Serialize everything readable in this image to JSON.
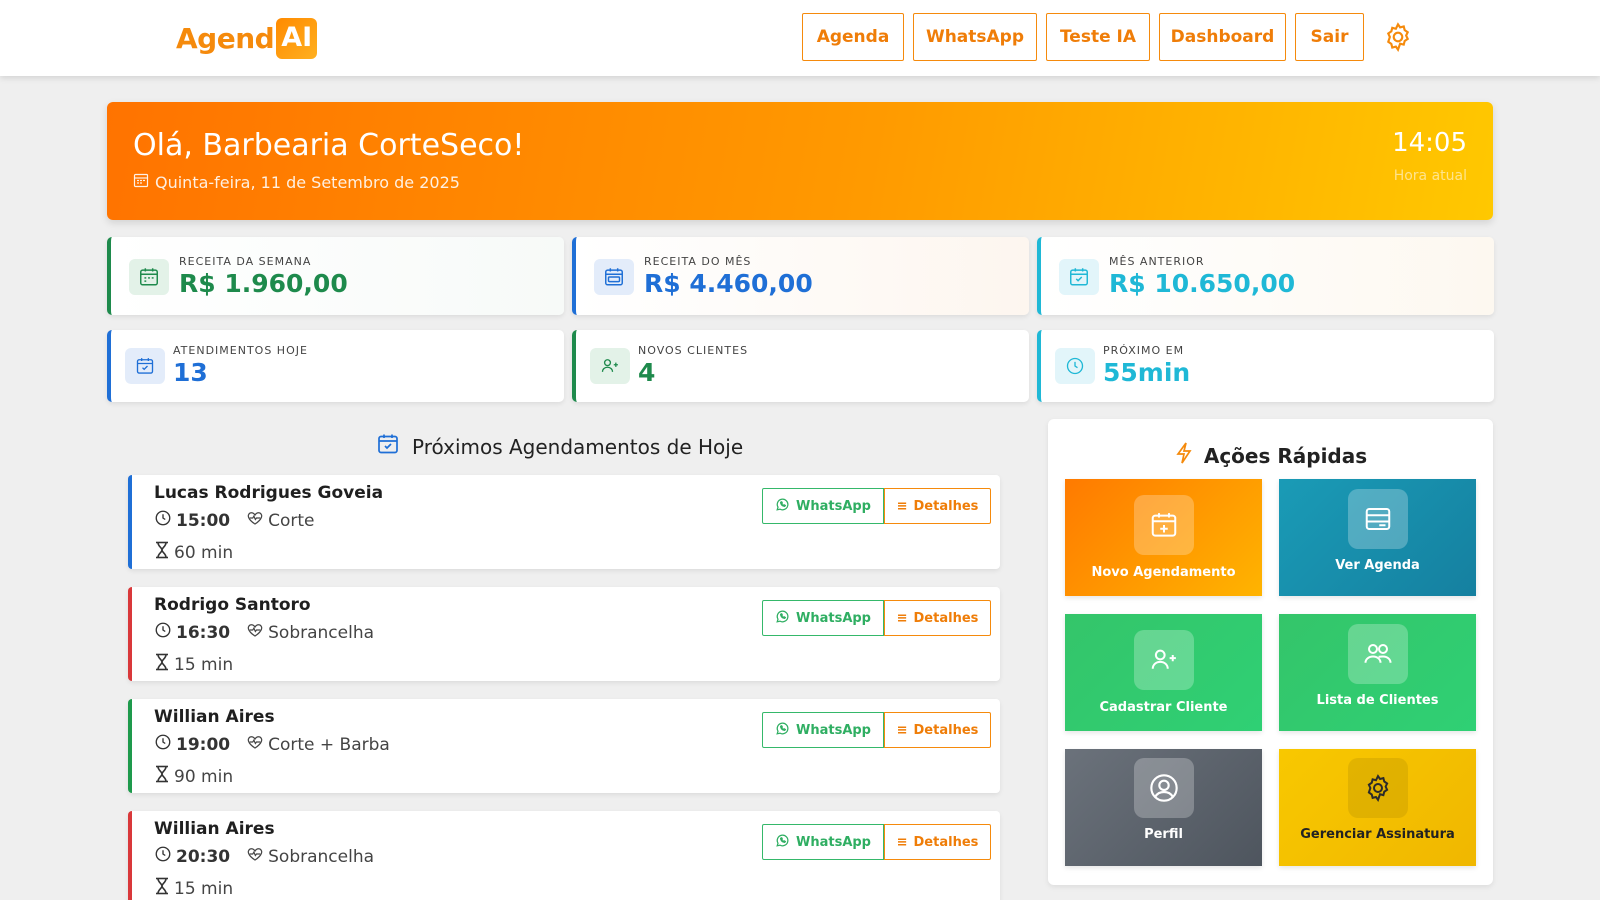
{
  "header": {
    "logo_text": "Agend",
    "logo_box": "AI",
    "nav": [
      "Agenda",
      "WhatsApp",
      "Teste IA",
      "Dashboard",
      "Sair"
    ]
  },
  "banner": {
    "greeting": "Olá, Barbearia CorteSeco!",
    "date": "Quinta-feira, 11 de Setembro de 2025",
    "time": "14:05",
    "time_label": "Hora atual"
  },
  "stats": [
    {
      "label": "RECEITA DA SEMANA",
      "value": "R$ 1.960,00",
      "color": "#1e8a4c"
    },
    {
      "label": "RECEITA DO MÊS",
      "value": "R$ 4.460,00",
      "color": "#1f6fd6"
    },
    {
      "label": "MÊS ANTERIOR",
      "value": "R$ 10.650,00",
      "color": "#1fb8d6"
    },
    {
      "label": "ATENDIMENTOS HOJE",
      "value": "13",
      "color": "#1f6fd6"
    },
    {
      "label": "NOVOS CLIENTES",
      "value": "4",
      "color": "#1e8a4c"
    },
    {
      "label": "PRÓXIMO EM",
      "value": "55min",
      "color": "#1fb8d6"
    }
  ],
  "appointments": {
    "title": "Próximos Agendamentos de Hoje",
    "whatsapp_label": "WhatsApp",
    "details_label": "Detalhes",
    "items": [
      {
        "name": "Lucas Rodrigues Goveia",
        "time": "15:00",
        "service": "Corte",
        "duration": "60 min",
        "color": "#1f6fd6"
      },
      {
        "name": "Rodrigo Santoro",
        "time": "16:30",
        "service": "Sobrancelha",
        "duration": "15 min",
        "color": "#d9383a"
      },
      {
        "name": "Willian Aires",
        "time": "19:00",
        "service": "Corte + Barba",
        "duration": "90 min",
        "color": "#1e9a4c"
      },
      {
        "name": "Willian Aires",
        "time": "20:30",
        "service": "Sobrancelha",
        "duration": "15 min",
        "color": "#d9383a"
      }
    ]
  },
  "quick_actions": {
    "title": "Ações Rápidas",
    "items": [
      {
        "label": "Novo Agendamento",
        "icon": "calendar-plus-icon"
      },
      {
        "label": "Ver Agenda",
        "icon": "agenda-list-icon"
      },
      {
        "label": "Cadastrar Cliente",
        "icon": "user-plus-icon"
      },
      {
        "label": "Lista de Clientes",
        "icon": "users-icon"
      },
      {
        "label": "Perfil",
        "icon": "user-circle-icon"
      },
      {
        "label": "Gerenciar Assinatura",
        "icon": "gear-icon"
      }
    ]
  },
  "colors": {
    "brand_orange": "#f58a0c",
    "green": "#1e8a4c",
    "blue": "#1f6fd6",
    "cyan": "#1fb8d6",
    "red": "#d9383a"
  }
}
